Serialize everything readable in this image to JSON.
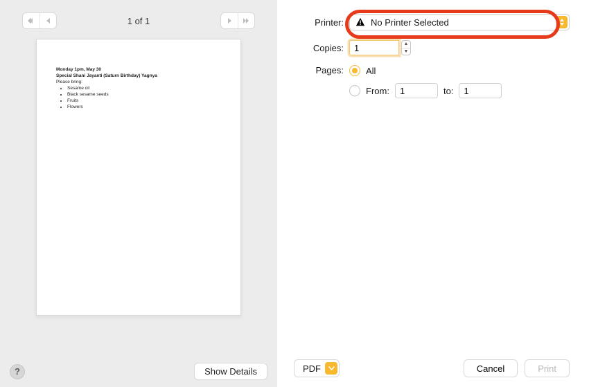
{
  "preview": {
    "page_indicator": "1 of 1",
    "doc": {
      "line1": "Monday 1pm, May 30",
      "line2": "Special Shani Jayanti (Saturn Birthday) Yagnya",
      "please_bring": "Please bring:",
      "items": [
        "Sesame oil",
        "Black sesame seeds",
        "Fruits",
        "Flowers"
      ]
    }
  },
  "labels": {
    "printer": "Printer:",
    "copies": "Copies:",
    "pages": "Pages:",
    "all": "All",
    "from": "From:",
    "to": "to:"
  },
  "printer": {
    "value": "No Printer Selected"
  },
  "copies": {
    "value": "1"
  },
  "pages": {
    "from": "1",
    "to": "1"
  },
  "buttons": {
    "help": "?",
    "show_details": "Show Details",
    "pdf": "PDF",
    "cancel": "Cancel",
    "print": "Print"
  }
}
